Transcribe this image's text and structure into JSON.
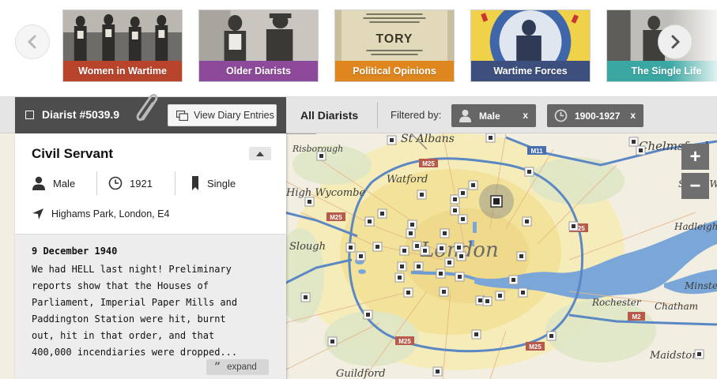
{
  "carousel": {
    "cards": [
      {
        "label": "Women in Wartime",
        "color": "#b8442c"
      },
      {
        "label": "Older Diarists",
        "color": "#8e4a9a"
      },
      {
        "label": "Political Opinions",
        "color": "#e0861e"
      },
      {
        "label": "Wartime Forces",
        "color": "#3d4f7d"
      },
      {
        "label": "The Single Life",
        "color": "#3aa7a3"
      }
    ],
    "card_tory_text": "TORY"
  },
  "filterbar": {
    "diarist_title": "Diarist #5039.9",
    "view_button": "View Diary Entries",
    "all_diarists": "All Diarists",
    "filtered_by": "Filtered by:",
    "chips": [
      {
        "label": "Male",
        "remove": "x",
        "icon": "person-icon"
      },
      {
        "label": "1900-1927",
        "remove": "x",
        "icon": "clock-icon"
      }
    ]
  },
  "panel": {
    "role": "Civil Servant",
    "gender": "Male",
    "birth_year": "1921",
    "status": "Single",
    "location": "Highams Park, London, E4",
    "entry": {
      "date": "9 December 1940",
      "lines": [
        "We had HELL last night! Preliminary",
        "reports show that the Houses of",
        "Parliament, Imperial Paper Mills and",
        "Paddington Station were hit, burnt",
        "out, hit in that order, and that",
        "400,000 incendiaries were dropped..."
      ]
    },
    "expand_label": "expand"
  },
  "map": {
    "zoom_in": "+",
    "zoom_out": "−",
    "places": [
      {
        "name": "London",
        "size": "big"
      },
      {
        "name": "St Albans"
      },
      {
        "name": "Chelmsford"
      },
      {
        "name": "Watford"
      },
      {
        "name": "High Wycombe"
      },
      {
        "name": "Slough"
      },
      {
        "name": "Rochester"
      },
      {
        "name": "Chatham"
      },
      {
        "name": "Maidstone"
      },
      {
        "name": "Guildford"
      },
      {
        "name": "Hadleigh"
      },
      {
        "name": "South W"
      },
      {
        "name": "Minste"
      },
      {
        "name": "Risborough"
      }
    ],
    "roads": [
      {
        "name": "M11"
      },
      {
        "name": "M25"
      },
      {
        "name": "M25"
      },
      {
        "name": "M25"
      },
      {
        "name": "M25"
      },
      {
        "name": "M25"
      },
      {
        "name": "M2"
      }
    ]
  }
}
